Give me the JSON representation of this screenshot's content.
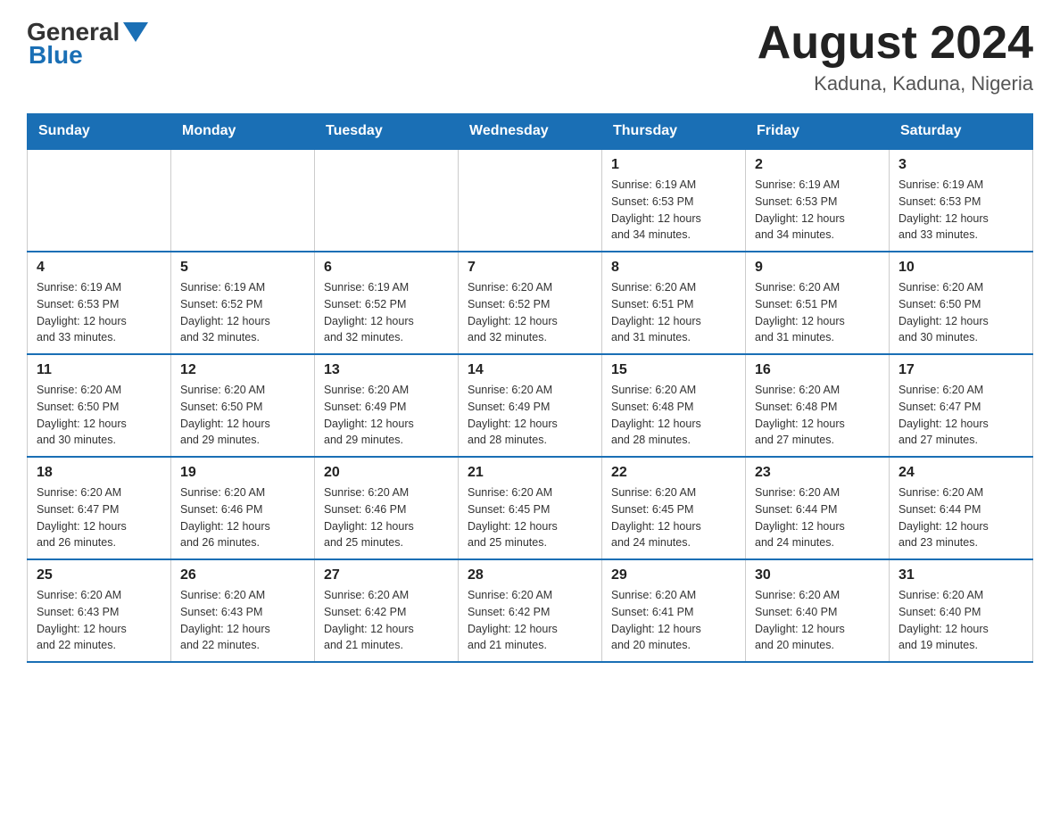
{
  "header": {
    "logo_general": "General",
    "logo_blue": "Blue",
    "month_title": "August 2024",
    "location": "Kaduna, Kaduna, Nigeria"
  },
  "weekdays": [
    "Sunday",
    "Monday",
    "Tuesday",
    "Wednesday",
    "Thursday",
    "Friday",
    "Saturday"
  ],
  "weeks": [
    [
      {
        "day": "",
        "info": ""
      },
      {
        "day": "",
        "info": ""
      },
      {
        "day": "",
        "info": ""
      },
      {
        "day": "",
        "info": ""
      },
      {
        "day": "1",
        "info": "Sunrise: 6:19 AM\nSunset: 6:53 PM\nDaylight: 12 hours\nand 34 minutes."
      },
      {
        "day": "2",
        "info": "Sunrise: 6:19 AM\nSunset: 6:53 PM\nDaylight: 12 hours\nand 34 minutes."
      },
      {
        "day": "3",
        "info": "Sunrise: 6:19 AM\nSunset: 6:53 PM\nDaylight: 12 hours\nand 33 minutes."
      }
    ],
    [
      {
        "day": "4",
        "info": "Sunrise: 6:19 AM\nSunset: 6:53 PM\nDaylight: 12 hours\nand 33 minutes."
      },
      {
        "day": "5",
        "info": "Sunrise: 6:19 AM\nSunset: 6:52 PM\nDaylight: 12 hours\nand 32 minutes."
      },
      {
        "day": "6",
        "info": "Sunrise: 6:19 AM\nSunset: 6:52 PM\nDaylight: 12 hours\nand 32 minutes."
      },
      {
        "day": "7",
        "info": "Sunrise: 6:20 AM\nSunset: 6:52 PM\nDaylight: 12 hours\nand 32 minutes."
      },
      {
        "day": "8",
        "info": "Sunrise: 6:20 AM\nSunset: 6:51 PM\nDaylight: 12 hours\nand 31 minutes."
      },
      {
        "day": "9",
        "info": "Sunrise: 6:20 AM\nSunset: 6:51 PM\nDaylight: 12 hours\nand 31 minutes."
      },
      {
        "day": "10",
        "info": "Sunrise: 6:20 AM\nSunset: 6:50 PM\nDaylight: 12 hours\nand 30 minutes."
      }
    ],
    [
      {
        "day": "11",
        "info": "Sunrise: 6:20 AM\nSunset: 6:50 PM\nDaylight: 12 hours\nand 30 minutes."
      },
      {
        "day": "12",
        "info": "Sunrise: 6:20 AM\nSunset: 6:50 PM\nDaylight: 12 hours\nand 29 minutes."
      },
      {
        "day": "13",
        "info": "Sunrise: 6:20 AM\nSunset: 6:49 PM\nDaylight: 12 hours\nand 29 minutes."
      },
      {
        "day": "14",
        "info": "Sunrise: 6:20 AM\nSunset: 6:49 PM\nDaylight: 12 hours\nand 28 minutes."
      },
      {
        "day": "15",
        "info": "Sunrise: 6:20 AM\nSunset: 6:48 PM\nDaylight: 12 hours\nand 28 minutes."
      },
      {
        "day": "16",
        "info": "Sunrise: 6:20 AM\nSunset: 6:48 PM\nDaylight: 12 hours\nand 27 minutes."
      },
      {
        "day": "17",
        "info": "Sunrise: 6:20 AM\nSunset: 6:47 PM\nDaylight: 12 hours\nand 27 minutes."
      }
    ],
    [
      {
        "day": "18",
        "info": "Sunrise: 6:20 AM\nSunset: 6:47 PM\nDaylight: 12 hours\nand 26 minutes."
      },
      {
        "day": "19",
        "info": "Sunrise: 6:20 AM\nSunset: 6:46 PM\nDaylight: 12 hours\nand 26 minutes."
      },
      {
        "day": "20",
        "info": "Sunrise: 6:20 AM\nSunset: 6:46 PM\nDaylight: 12 hours\nand 25 minutes."
      },
      {
        "day": "21",
        "info": "Sunrise: 6:20 AM\nSunset: 6:45 PM\nDaylight: 12 hours\nand 25 minutes."
      },
      {
        "day": "22",
        "info": "Sunrise: 6:20 AM\nSunset: 6:45 PM\nDaylight: 12 hours\nand 24 minutes."
      },
      {
        "day": "23",
        "info": "Sunrise: 6:20 AM\nSunset: 6:44 PM\nDaylight: 12 hours\nand 24 minutes."
      },
      {
        "day": "24",
        "info": "Sunrise: 6:20 AM\nSunset: 6:44 PM\nDaylight: 12 hours\nand 23 minutes."
      }
    ],
    [
      {
        "day": "25",
        "info": "Sunrise: 6:20 AM\nSunset: 6:43 PM\nDaylight: 12 hours\nand 22 minutes."
      },
      {
        "day": "26",
        "info": "Sunrise: 6:20 AM\nSunset: 6:43 PM\nDaylight: 12 hours\nand 22 minutes."
      },
      {
        "day": "27",
        "info": "Sunrise: 6:20 AM\nSunset: 6:42 PM\nDaylight: 12 hours\nand 21 minutes."
      },
      {
        "day": "28",
        "info": "Sunrise: 6:20 AM\nSunset: 6:42 PM\nDaylight: 12 hours\nand 21 minutes."
      },
      {
        "day": "29",
        "info": "Sunrise: 6:20 AM\nSunset: 6:41 PM\nDaylight: 12 hours\nand 20 minutes."
      },
      {
        "day": "30",
        "info": "Sunrise: 6:20 AM\nSunset: 6:40 PM\nDaylight: 12 hours\nand 20 minutes."
      },
      {
        "day": "31",
        "info": "Sunrise: 6:20 AM\nSunset: 6:40 PM\nDaylight: 12 hours\nand 19 minutes."
      }
    ]
  ]
}
